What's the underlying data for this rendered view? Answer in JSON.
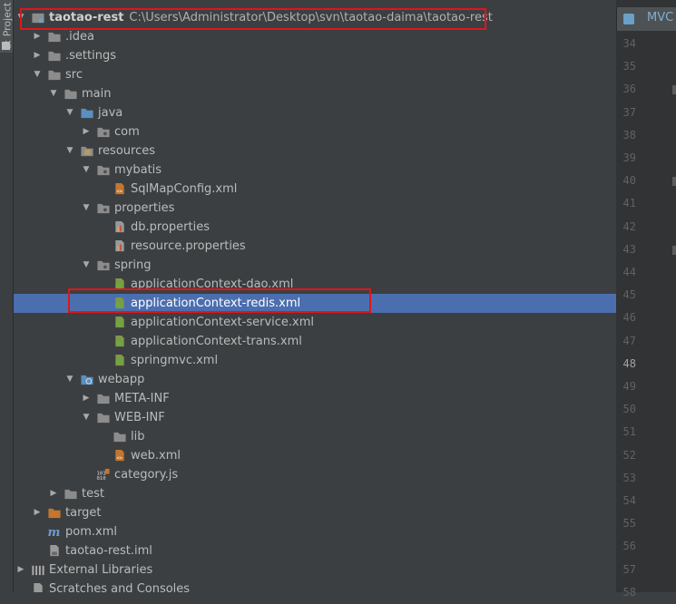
{
  "toolwindow": {
    "label": "1: Project"
  },
  "tree": {
    "rows": [
      {
        "label": "taotao-rest",
        "path": "C:\\Users\\Administrator\\Desktop\\svn\\taotao-daima\\taotao-rest",
        "indent": 0,
        "arrow": "down",
        "icon": "module",
        "bold": true,
        "selected": false
      },
      {
        "label": ".idea",
        "indent": 1,
        "arrow": "right",
        "icon": "folder",
        "selected": false
      },
      {
        "label": ".settings",
        "indent": 1,
        "arrow": "right",
        "icon": "folder",
        "selected": false
      },
      {
        "label": "src",
        "indent": 1,
        "arrow": "down",
        "icon": "folder",
        "selected": false
      },
      {
        "label": "main",
        "indent": 2,
        "arrow": "down",
        "icon": "folder",
        "selected": false
      },
      {
        "label": "java",
        "indent": 3,
        "arrow": "down",
        "icon": "source-folder",
        "selected": false
      },
      {
        "label": "com",
        "indent": 4,
        "arrow": "right",
        "icon": "package",
        "selected": false
      },
      {
        "label": "resources",
        "indent": 3,
        "arrow": "down",
        "icon": "resource-folder",
        "selected": false
      },
      {
        "label": "mybatis",
        "indent": 4,
        "arrow": "down",
        "icon": "package",
        "selected": false
      },
      {
        "label": "SqlMapConfig.xml",
        "indent": 5,
        "arrow": "none",
        "icon": "xml-file",
        "selected": false
      },
      {
        "label": "properties",
        "indent": 4,
        "arrow": "down",
        "icon": "package",
        "selected": false
      },
      {
        "label": "db.properties",
        "indent": 5,
        "arrow": "none",
        "icon": "properties-file",
        "selected": false
      },
      {
        "label": "resource.properties",
        "indent": 5,
        "arrow": "none",
        "icon": "properties-file",
        "selected": false
      },
      {
        "label": "spring",
        "indent": 4,
        "arrow": "down",
        "icon": "package",
        "selected": false
      },
      {
        "label": "applicationContext-dao.xml",
        "indent": 5,
        "arrow": "none",
        "icon": "spring-xml-file",
        "selected": false
      },
      {
        "label": "applicationContext-redis.xml",
        "indent": 5,
        "arrow": "none",
        "icon": "spring-xml-file",
        "selected": true
      },
      {
        "label": "applicationContext-service.xml",
        "indent": 5,
        "arrow": "none",
        "icon": "spring-xml-file",
        "selected": false
      },
      {
        "label": "applicationContext-trans.xml",
        "indent": 5,
        "arrow": "none",
        "icon": "spring-xml-file",
        "selected": false
      },
      {
        "label": "springmvc.xml",
        "indent": 5,
        "arrow": "none",
        "icon": "spring-xml-file",
        "selected": false
      },
      {
        "label": "webapp",
        "indent": 3,
        "arrow": "down",
        "icon": "web-folder",
        "selected": false
      },
      {
        "label": "META-INF",
        "indent": 4,
        "arrow": "right",
        "icon": "folder",
        "selected": false
      },
      {
        "label": "WEB-INF",
        "indent": 4,
        "arrow": "down",
        "icon": "folder",
        "selected": false
      },
      {
        "label": "lib",
        "indent": 5,
        "arrow": "none",
        "icon": "folder",
        "selected": false
      },
      {
        "label": "web.xml",
        "indent": 5,
        "arrow": "none",
        "icon": "xml-file",
        "selected": false
      },
      {
        "label": "category.js",
        "indent": 4,
        "arrow": "none",
        "icon": "binary-file",
        "selected": false
      },
      {
        "label": "test",
        "indent": 2,
        "arrow": "right",
        "icon": "folder",
        "selected": false
      },
      {
        "label": "target",
        "indent": 1,
        "arrow": "right",
        "icon": "excluded-folder",
        "selected": false
      },
      {
        "label": "pom.xml",
        "indent": 1,
        "arrow": "none",
        "icon": "maven-file",
        "selected": false
      },
      {
        "label": "taotao-rest.iml",
        "indent": 1,
        "arrow": "none",
        "icon": "iml-file",
        "selected": false
      },
      {
        "label": "External Libraries",
        "indent": 0,
        "arrow": "right",
        "icon": "libraries",
        "selected": false
      },
      {
        "label": "Scratches and Consoles",
        "indent": 0,
        "arrow": "none",
        "icon": "scratches",
        "selected": false
      }
    ]
  },
  "editor": {
    "tab_label": "MVC",
    "line_numbers": [
      "34",
      "35",
      "36",
      "37",
      "38",
      "39",
      "40",
      "41",
      "42",
      "43",
      "44",
      "45",
      "46",
      "47",
      "48",
      "49",
      "50",
      "51",
      "52",
      "53",
      "54",
      "55",
      "56",
      "57",
      "58"
    ],
    "current_line": "48"
  },
  "colors": {
    "background": "#3c3f41",
    "selection": "#4b6eaf",
    "annotation": "#e0151a",
    "editor_gutter": "#313335"
  }
}
